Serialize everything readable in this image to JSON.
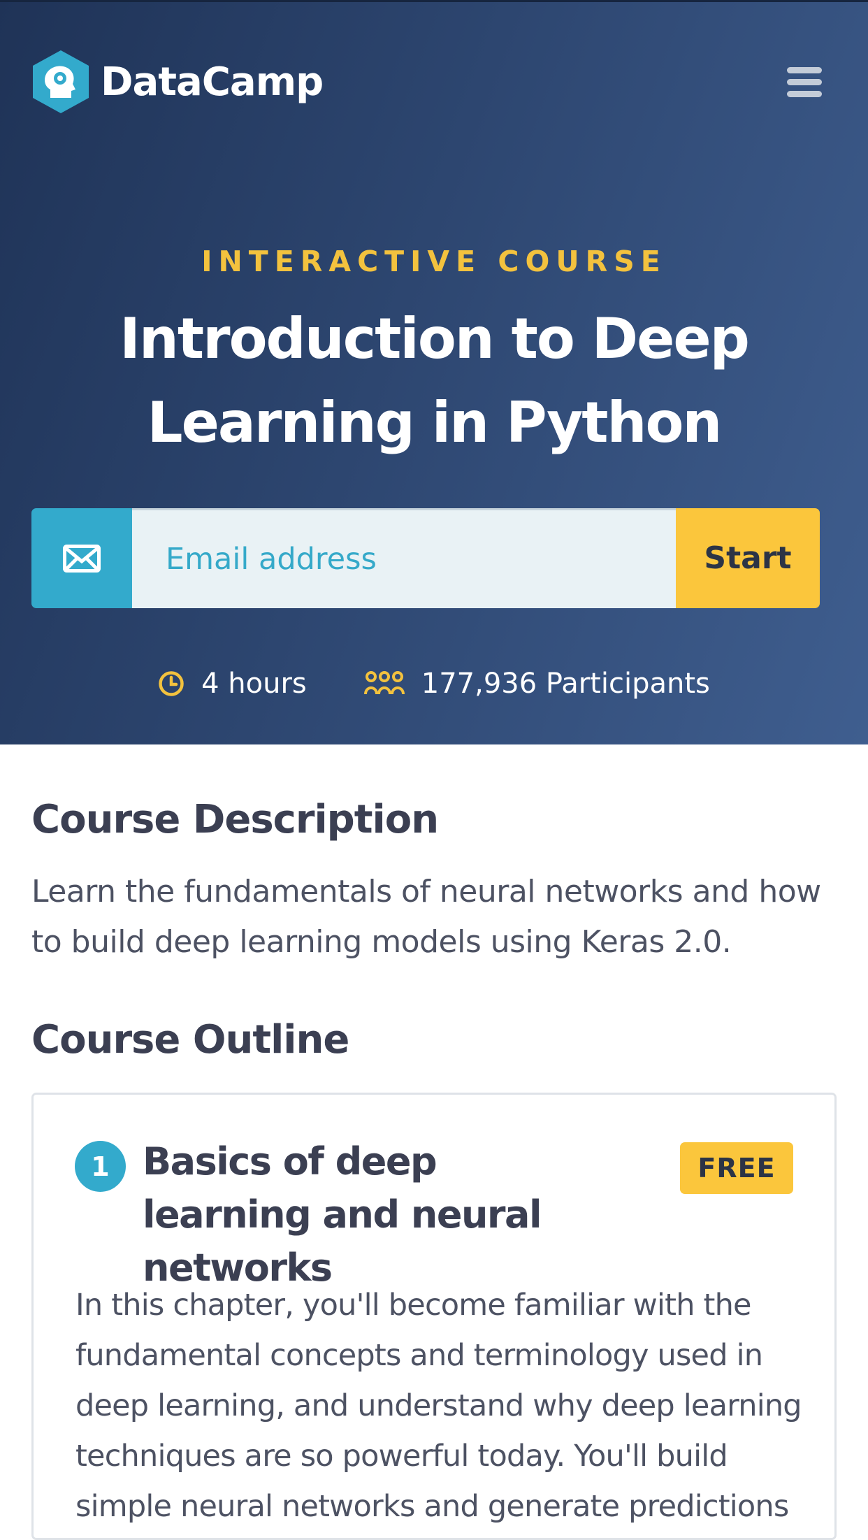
{
  "header": {
    "brand": "DataCamp",
    "eyebrow": "INTERACTIVE COURSE",
    "title": "Introduction to Deep Learning in Python"
  },
  "signup": {
    "email_placeholder": "Email address",
    "start_label": "Start"
  },
  "stats": {
    "duration": "4 hours",
    "participants": "177,936 Participants"
  },
  "description": {
    "heading": "Course Description",
    "text": "Learn the fundamentals of neural networks and how to build deep learning models using Keras 2.0."
  },
  "outline": {
    "heading": "Course Outline",
    "chapters": [
      {
        "number": "1",
        "title": "Basics of deep learning and neural networks",
        "badge": "FREE",
        "text": "In this chapter, you'll become familiar with the fundamental concepts and terminology used in deep learning, and understand why deep learning techniques are so powerful today. You'll build simple neural networks and generate predictions"
      }
    ]
  },
  "colors": {
    "hero_dark": "#1f3357",
    "hero_light": "#3f5e8f",
    "accent_yellow": "#fbc63c",
    "accent_blue": "#33aacc"
  },
  "icons": [
    "datacamp-logo-icon",
    "menu-icon",
    "mail-icon",
    "clock-icon",
    "participants-icon"
  ]
}
